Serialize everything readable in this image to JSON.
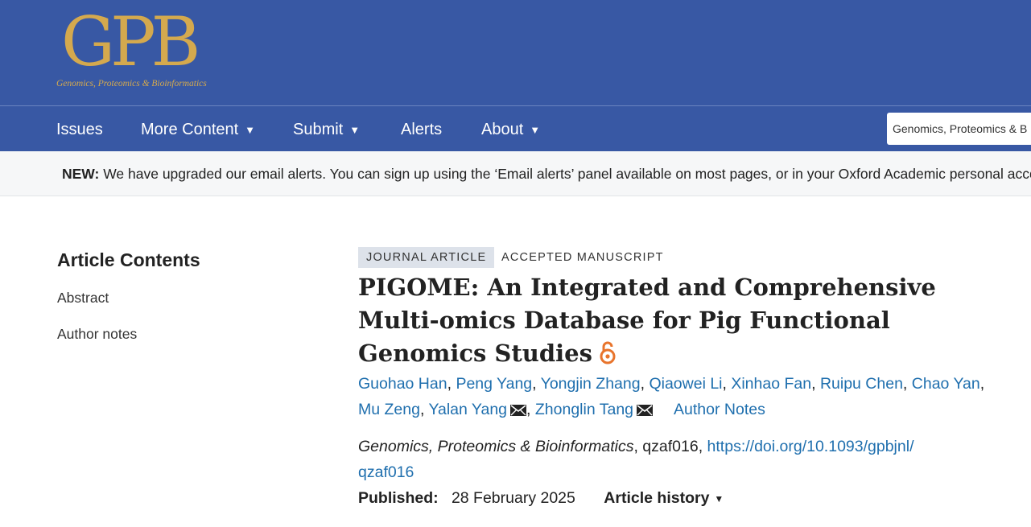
{
  "header": {
    "logo_text": "GPB",
    "logo_subtitle": "Genomics, Proteomics & Bioinformatics",
    "colors": {
      "header_bg": "#3858a4",
      "logo_gold": "#d4a94e"
    }
  },
  "nav": {
    "items": [
      {
        "label": "Issues",
        "has_dropdown": false
      },
      {
        "label": "More Content",
        "has_dropdown": true
      },
      {
        "label": "Submit",
        "has_dropdown": true
      },
      {
        "label": "Alerts",
        "has_dropdown": false
      },
      {
        "label": "About",
        "has_dropdown": true
      }
    ],
    "search_value": "Genomics, Proteomics & B"
  },
  "notice": {
    "label": "NEW:",
    "text": "We have upgraded our email alerts. You can sign up using the ‘Email alerts’ panel available on most pages, or in your Oxford Academic personal accou"
  },
  "toc": {
    "title": "Article Contents",
    "items": [
      "Abstract",
      "Author notes"
    ]
  },
  "article": {
    "type_badge": "JOURNAL ARTICLE",
    "status": "ACCEPTED MANUSCRIPT",
    "title": "PIGOME: An Integrated and Comprehensive Multi-omics Database for Pig Functional Genomics Studies",
    "open_access_icon": "open-access-lock-icon",
    "authors": [
      "Guohao Han",
      "Peng Yang",
      "Yongjin Zhang",
      "Qiaowei Li",
      "Xinhao Fan",
      "Ruipu Chen",
      "Chao Yan",
      "Mu Zeng",
      "Yalan Yang",
      "Zhonglin Tang"
    ],
    "corresponding_icon": "envelope-icon",
    "author_notes_label": "Author Notes",
    "journal": "Genomics, Proteomics & Bioinformatics",
    "article_id": "qzaf016",
    "doi_part1": "https://doi.org/10.1093/gpbjnl/",
    "doi_part2": "qzaf016",
    "published_label": "Published:",
    "published_date": "28 February 2025",
    "history_label": "Article history"
  }
}
